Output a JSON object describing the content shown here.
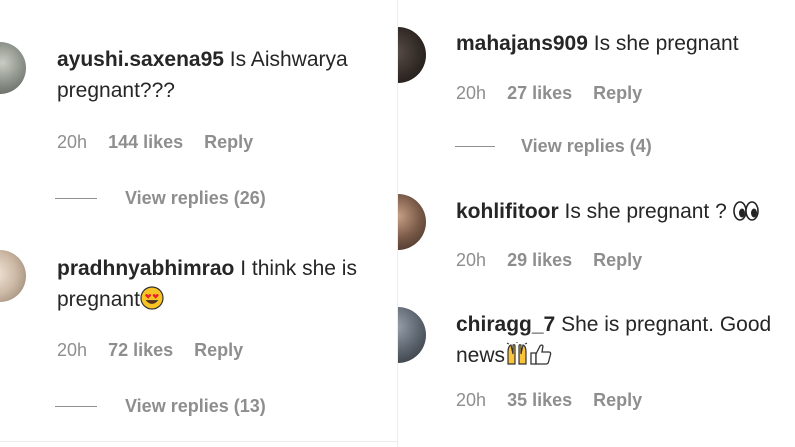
{
  "comments": [
    {
      "username": "ayushi.saxena95",
      "text": "Is Aishwarya pregnant???",
      "time": "20h",
      "likes": "144 likes",
      "reply": "Reply",
      "view_replies": "View replies (26)"
    },
    {
      "username": "pradhnyabhimrao",
      "text": "I think she is pregnant",
      "emoji": "heart-eyes-icon",
      "time": "20h",
      "likes": "72 likes",
      "reply": "Reply",
      "view_replies": "View replies (13)"
    },
    {
      "username": "mahajans909",
      "text": "Is she pregnant",
      "time": "20h",
      "likes": "27 likes",
      "reply": "Reply",
      "view_replies": "View replies (4)"
    },
    {
      "username": "kohlifitoor",
      "text": "Is she pregnant ?",
      "emoji": "eyes-icon",
      "time": "20h",
      "likes": "29 likes",
      "reply": "Reply"
    },
    {
      "username": "chiragg_7",
      "text": "She is pregnant. Good news",
      "emoji": "raised-hands-icon thumbs-up-icon",
      "time": "20h",
      "likes": "35 likes",
      "reply": "Reply"
    }
  ]
}
